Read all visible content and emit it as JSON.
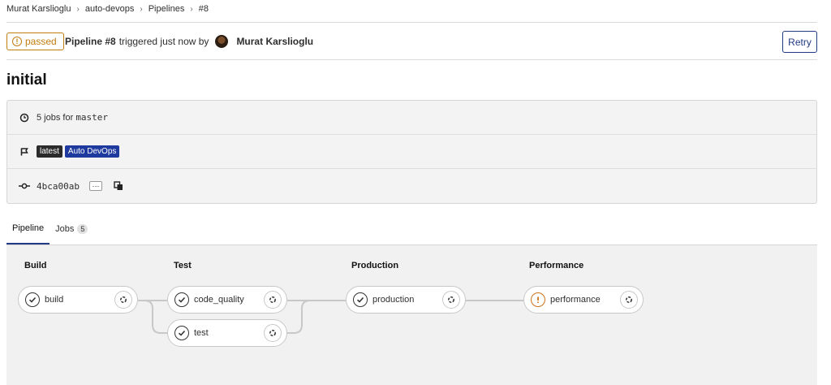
{
  "breadcrumb": [
    "Murat Karslioglu",
    "auto-devops",
    "Pipelines",
    "#8"
  ],
  "header": {
    "status": "passed",
    "pipeline_label": "Pipeline #8",
    "triggered_text": "triggered just now by",
    "user": "Murat Karslioglu",
    "retry_label": "Retry"
  },
  "title": "initial",
  "info": {
    "jobs_text": "5 jobs for",
    "branch": "master",
    "tags": [
      "latest",
      "Auto DevOps"
    ],
    "commit_sha": "4bca00ab",
    "ellipsis": "···"
  },
  "tabs": {
    "pipeline": "Pipeline",
    "jobs": "Jobs",
    "jobs_count": "5"
  },
  "stages": {
    "build": {
      "name": "Build",
      "jobs": [
        "build"
      ]
    },
    "test": {
      "name": "Test",
      "jobs": [
        "code_quality",
        "test"
      ]
    },
    "production": {
      "name": "Production",
      "jobs": [
        "production"
      ]
    },
    "performance": {
      "name": "Performance",
      "jobs": [
        "performance"
      ]
    }
  },
  "job_statuses": {
    "build": "success",
    "code_quality": "success",
    "test": "success",
    "production": "success",
    "performance": "warning"
  },
  "colors": {
    "passed": "#c17d10",
    "primary": "#1f3a82",
    "devops_tag": "#1f3a9e",
    "warning": "#d0711a"
  }
}
